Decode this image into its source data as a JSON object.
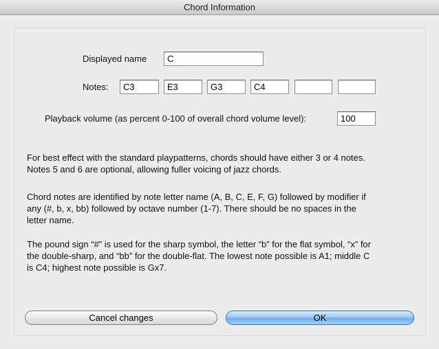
{
  "window": {
    "title": "Chord Information"
  },
  "form": {
    "displayed_name_label": "Displayed name",
    "displayed_name_value": "C",
    "notes_label": "Notes:",
    "notes": [
      "C3",
      "E3",
      "G3",
      "C4",
      "",
      ""
    ],
    "playback_label": "Playback volume (as percent 0-100 of overall chord volume level):",
    "playback_value": "100"
  },
  "help": {
    "p1_line1": "For best effect with the standard playpatterns, chords should have either 3 or 4 notes.",
    "p1_line2": "Notes 5 and 6 are optional, allowing fuller voicing of jazz chords.",
    "p2_line1": "Chord notes are identified by note letter name (A, B, C, E, F, G) followed by modifier if",
    "p2_line2": "any (#, b, x, bb) followed by octave number (1-7). There should be no spaces in the",
    "p2_line3": "letter name.",
    "p3_line1": "The pound sign “#” is used for the sharp symbol, the letter “b” for the flat symbol, “x” for",
    "p3_line2": "the double-sharp, and “bb” for the double-flat. The lowest note possible is A1; middle C",
    "p3_line3": "is C4; highest note possible is Gx7."
  },
  "buttons": {
    "cancel": "Cancel changes",
    "ok": "OK"
  }
}
